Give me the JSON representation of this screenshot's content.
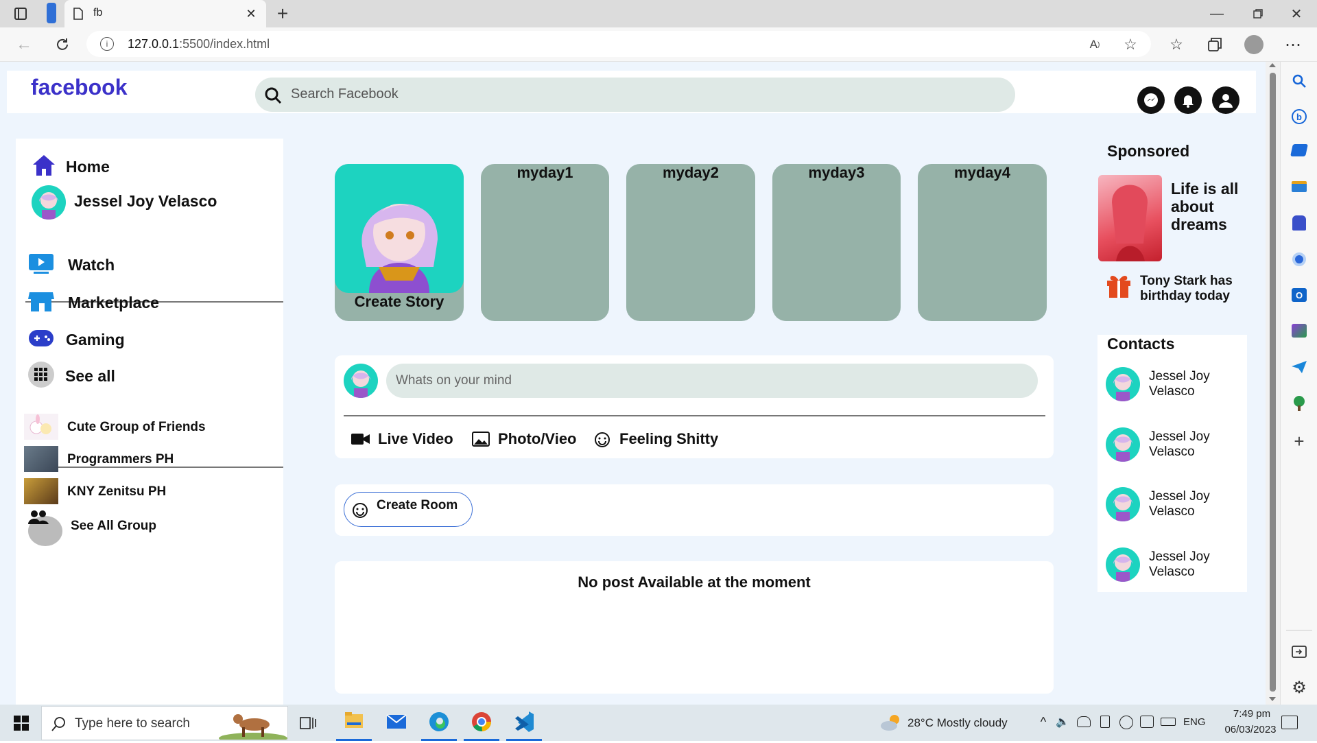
{
  "browser": {
    "tab_title": "fb",
    "url_host": "127.0.0.1",
    "url_rest": ":5500/index.html"
  },
  "header": {
    "logo": "facebook",
    "search_placeholder": "Search Facebook"
  },
  "sidebar": {
    "home": "Home",
    "profile_name": "Jessel Joy Velasco",
    "watch": "Watch",
    "marketplace": "Marketplace",
    "gaming": "Gaming",
    "see_all": "See all",
    "groups": [
      "Cute Group of Friends",
      "Programmers PH",
      "KNY Zenitsu PH"
    ],
    "see_all_group": "See All Group"
  },
  "stories": {
    "create": "Create Story",
    "items": [
      "myday1",
      "myday2",
      "myday3",
      "myday4"
    ]
  },
  "composer": {
    "placeholder": "Whats on your mind",
    "live_video": "Live Video",
    "photo_video": "Photo/Vieo",
    "feeling": "Feeling Shitty"
  },
  "room": {
    "create_room": "Create Room"
  },
  "feed": {
    "empty": "No post Available at the moment"
  },
  "sponsored": {
    "title": "Sponsored",
    "ad_text": "Life is all about dreams",
    "birthday": "Tony Stark has birthday today"
  },
  "contacts": {
    "title": "Contacts",
    "items": [
      "Jessel Joy Velasco",
      "Jessel Joy Velasco",
      "Jessel Joy Velasco",
      "Jessel Joy Velasco"
    ]
  },
  "taskbar": {
    "search_placeholder": "Type here to search",
    "weather": "28°C  Mostly cloudy",
    "lang": "ENG",
    "time": "7:49 pm",
    "date": "06/03/2023"
  },
  "colors": {
    "brand": "#3b31c9",
    "page_bg": "#eef5fd",
    "story_bg": "#96b2a8",
    "avatar_bg": "#1dd3c0"
  }
}
